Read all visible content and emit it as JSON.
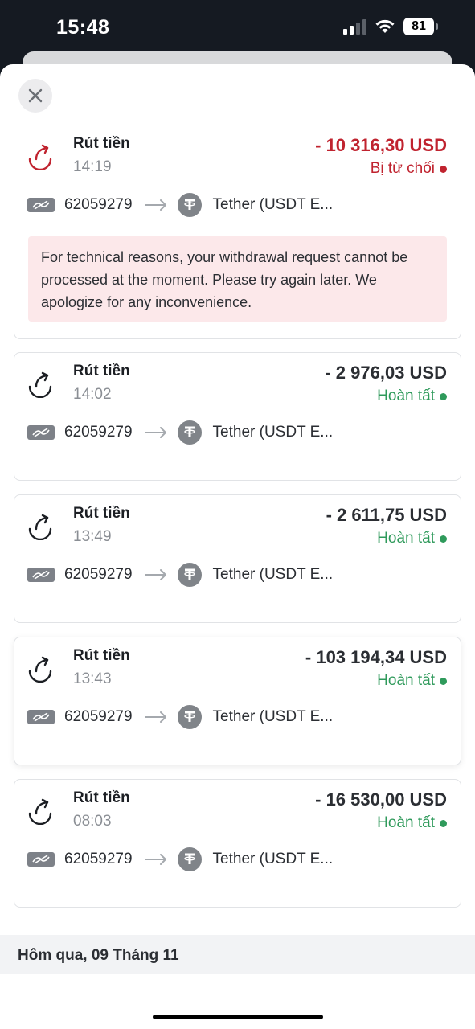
{
  "status_bar": {
    "time": "15:48",
    "battery": "81"
  },
  "header": {
    "close_icon": "close-icon"
  },
  "transactions": [
    {
      "title": "Rút tiền",
      "time": "14:19",
      "amount": "- 10 316,30 USD",
      "status": "Bị từ chối",
      "status_color": "#c0232f",
      "account": "62059279",
      "destination": "Tether (USDT E...",
      "message": "For technical reasons, your withdrawal request cannot be processed at the moment. Please try again later. We apologize for any inconvenience."
    },
    {
      "title": "Rút tiền",
      "time": "14:02",
      "amount": "- 2 976,03 USD",
      "status": "Hoàn tất",
      "status_color": "#2f9a5b",
      "account": "62059279",
      "destination": "Tether (USDT E..."
    },
    {
      "title": "Rút tiền",
      "time": "13:49",
      "amount": "- 2 611,75 USD",
      "status": "Hoàn tất",
      "status_color": "#2f9a5b",
      "account": "62059279",
      "destination": "Tether (USDT E..."
    },
    {
      "title": "Rút tiền",
      "time": "13:43",
      "amount": "- 103 194,34 USD",
      "status": "Hoàn tất",
      "status_color": "#2f9a5b",
      "account": "62059279",
      "destination": "Tether (USDT E..."
    },
    {
      "title": "Rút tiền",
      "time": "08:03",
      "amount": "- 16 530,00 USD",
      "status": "Hoàn tất",
      "status_color": "#2f9a5b",
      "account": "62059279",
      "destination": "Tether (USDT E..."
    }
  ],
  "section": {
    "label": "Hôm qua, 09 Tháng 11"
  }
}
